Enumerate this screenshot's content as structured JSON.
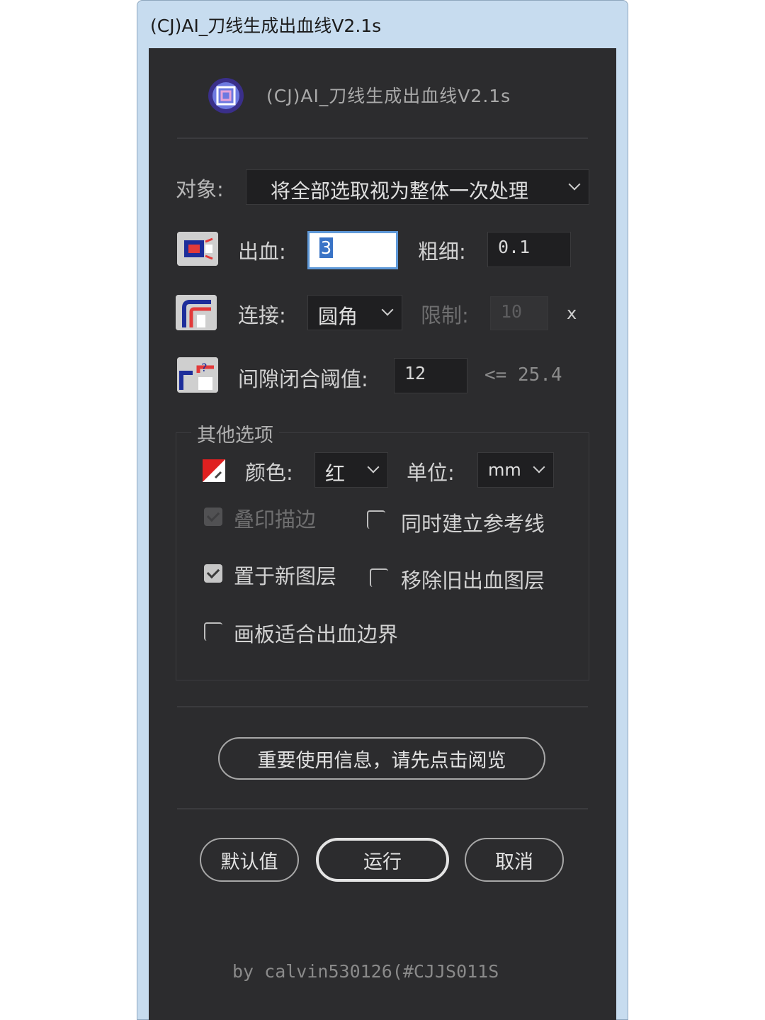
{
  "window": {
    "title": "(CJ)AI_刀线生成出血线V2.1s"
  },
  "header": {
    "icon": "app-logo-icon",
    "title": "(CJ)AI_刀线生成出血线V2.1s"
  },
  "target": {
    "label": "对象:",
    "selected": "将全部选取视为整体一次处理"
  },
  "bleed": {
    "label": "出血:",
    "value": "3",
    "weight_label": "粗细:",
    "weight_value": "0.1"
  },
  "join": {
    "label": "连接:",
    "selected": "圆角",
    "limit_label": "限制:",
    "limit_value": "10",
    "limit_suffix": "x"
  },
  "gap": {
    "label": "间隙闭合阈值:",
    "value": "12",
    "max_text": "<= 25.4"
  },
  "other": {
    "legend": "其他选项",
    "color_label": "颜色:",
    "color_value": "红",
    "color_swatch": "#e02020",
    "unit_label": "单位:",
    "unit_value": "mm",
    "opt_overprint": "叠印描边",
    "opt_reference": "同时建立参考线",
    "opt_new_layer": "置于新图层",
    "opt_remove_old": "移除旧出血图层",
    "opt_artboard": "画板适合出血边界"
  },
  "info_button": "重要使用信息，请先点击阅览",
  "buttons": {
    "default": "默认值",
    "run": "运行",
    "cancel": "取消"
  },
  "footer": {
    "credit": "by calvin530126(#CJJS011S"
  }
}
